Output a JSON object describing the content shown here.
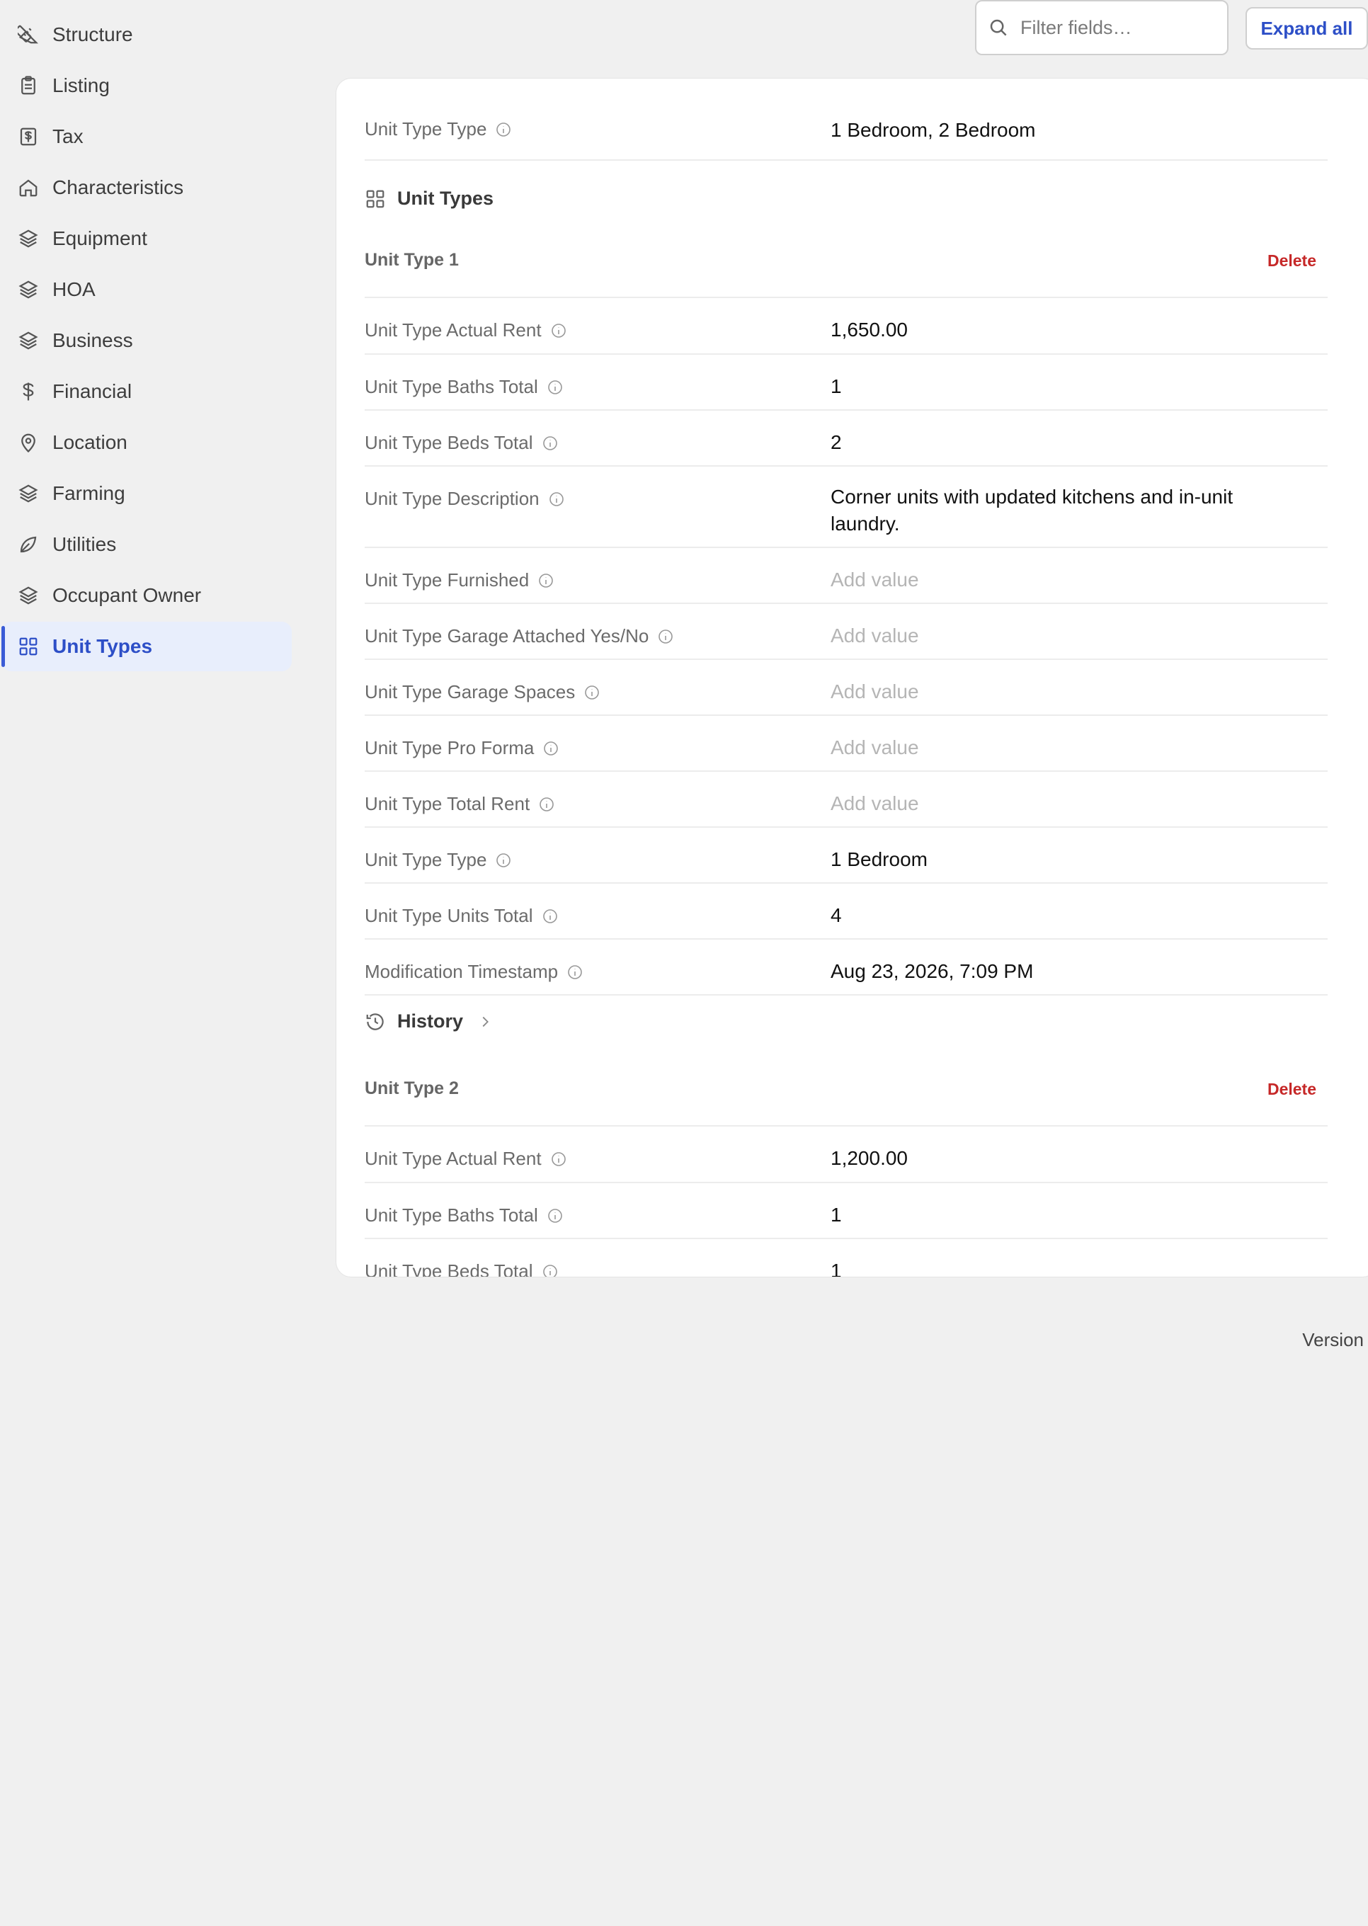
{
  "topbar": {
    "filter_placeholder": "Filter fields…",
    "expand_label": "Expand all"
  },
  "sidebar": {
    "items": [
      {
        "label": "Structure",
        "icon": "ruler-icon"
      },
      {
        "label": "Listing",
        "icon": "clipboard-icon"
      },
      {
        "label": "Tax",
        "icon": "receipt-icon"
      },
      {
        "label": "Characteristics",
        "icon": "home-icon"
      },
      {
        "label": "Equipment",
        "icon": "layers-icon"
      },
      {
        "label": "HOA",
        "icon": "layers-icon"
      },
      {
        "label": "Business",
        "icon": "layers-icon"
      },
      {
        "label": "Financial",
        "icon": "dollar-icon"
      },
      {
        "label": "Location",
        "icon": "map-pin-icon"
      },
      {
        "label": "Farming",
        "icon": "layers-icon"
      },
      {
        "label": "Utilities",
        "icon": "leaf-icon"
      },
      {
        "label": "Occupant Owner",
        "icon": "layers-icon"
      },
      {
        "label": "Unit Types",
        "icon": "grid-icon",
        "active": true
      }
    ]
  },
  "main": {
    "summary": {
      "label": "Unit Type Type",
      "value": "1 Bedroom, 2 Bedroom"
    },
    "section_title": "Unit Types",
    "history_label": "History",
    "delete_label": "Delete",
    "add_value_placeholder": "Add value",
    "unit_types": [
      {
        "title": "Unit Type 1",
        "fields": [
          {
            "label": "Unit Type Actual Rent",
            "value": "1,650.00"
          },
          {
            "label": "Unit Type Baths Total",
            "value": "1"
          },
          {
            "label": "Unit Type Beds Total",
            "value": "2"
          },
          {
            "label": "Unit Type Description",
            "value": "Corner units with updated kitchens and in-unit laundry."
          },
          {
            "label": "Unit Type Furnished",
            "value": "Add value"
          },
          {
            "label": "Unit Type Garage Attached Yes/No",
            "value": "Add value"
          },
          {
            "label": "Unit Type Garage Spaces",
            "value": "Add value"
          },
          {
            "label": "Unit Type Pro Forma",
            "value": "Add value"
          },
          {
            "label": "Unit Type Total Rent",
            "value": "Add value"
          },
          {
            "label": "Unit Type Type",
            "value": "1 Bedroom"
          },
          {
            "label": "Unit Type Units Total",
            "value": "4"
          },
          {
            "label": "Modification Timestamp",
            "value": "Aug 23, 2026, 7:09 PM"
          }
        ]
      },
      {
        "title": "Unit Type 2",
        "fields": [
          {
            "label": "Unit Type Actual Rent",
            "value": "1,200.00"
          },
          {
            "label": "Unit Type Baths Total",
            "value": "1"
          },
          {
            "label": "Unit Type Beds Total",
            "value": "1"
          }
        ]
      }
    ]
  },
  "footer": {
    "version_label": "Version"
  },
  "colors": {
    "accent": "#2d4fc7",
    "danger": "#c62828",
    "muted": "#6b6b6b",
    "placeholder": "#b5b5b5"
  }
}
